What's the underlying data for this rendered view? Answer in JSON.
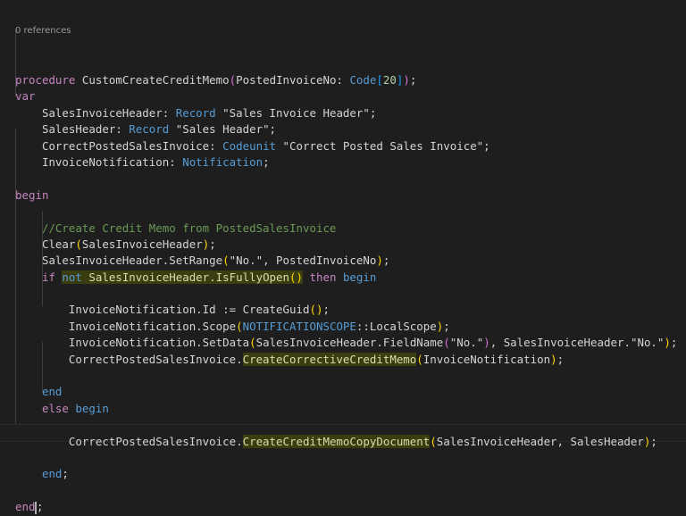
{
  "editor": {
    "codelens": "0 references",
    "lines": [
      [
        [
          "procedure ",
          "k"
        ],
        [
          "CustomCreateCreditMemo",
          "p"
        ],
        [
          "(",
          "b2"
        ],
        [
          "PostedInvoiceNo: ",
          "p"
        ],
        [
          "Code",
          "t"
        ],
        [
          "[",
          "b3"
        ],
        [
          "20",
          "n"
        ],
        [
          "]",
          "b3"
        ],
        [
          ")",
          "b2"
        ],
        [
          ";",
          "p"
        ]
      ],
      [
        [
          "var",
          "k"
        ]
      ],
      [
        [
          "    SalesInvoiceHeader: ",
          "p"
        ],
        [
          "Record",
          "t"
        ],
        [
          " \"Sales Invoice Header\";",
          "s"
        ]
      ],
      [
        [
          "    SalesHeader: ",
          "p"
        ],
        [
          "Record",
          "t"
        ],
        [
          " \"Sales Header\";",
          "s"
        ]
      ],
      [
        [
          "    CorrectPostedSalesInvoice: ",
          "p"
        ],
        [
          "Codeunit",
          "t"
        ],
        [
          " \"Correct Posted Sales Invoice\";",
          "s"
        ]
      ],
      [
        [
          "    InvoiceNotification: ",
          "p"
        ],
        [
          "Notification",
          "t"
        ],
        [
          ";",
          "p"
        ]
      ],
      [],
      [
        [
          "begin",
          "k"
        ]
      ],
      [],
      [
        [
          "    //Create Credit Memo from PostedSalesInvoice",
          "c"
        ]
      ],
      [
        [
          "    Clear",
          "p"
        ],
        [
          "(",
          "b1"
        ],
        [
          "SalesInvoiceHeader",
          "p"
        ],
        [
          ")",
          "b1"
        ],
        [
          ";",
          "p"
        ]
      ],
      [
        [
          "    SalesInvoiceHeader.SetRange",
          "p"
        ],
        [
          "(",
          "b1"
        ],
        [
          "\"No.\", PostedInvoiceNo",
          "p"
        ],
        [
          ")",
          "b1"
        ],
        [
          ";",
          "p"
        ]
      ],
      [
        [
          "    if ",
          "k"
        ],
        [
          "not ",
          "t h"
        ],
        [
          "SalesInvoiceHeader.IsFullyOpen",
          "f h"
        ],
        [
          "()",
          "b1 h"
        ],
        [
          " then ",
          "k"
        ],
        [
          "begin",
          "t"
        ]
      ],
      [],
      [
        [
          "        InvoiceNotification.Id := CreateGuid",
          "p"
        ],
        [
          "()",
          "b1"
        ],
        [
          ";",
          "p"
        ]
      ],
      [
        [
          "        InvoiceNotification.Scope",
          "p"
        ],
        [
          "(",
          "b1"
        ],
        [
          "NOTIFICATIONSCOPE",
          "t"
        ],
        [
          "::LocalScope",
          "p"
        ],
        [
          ")",
          "b1"
        ],
        [
          ";",
          "p"
        ]
      ],
      [
        [
          "        InvoiceNotification.SetData",
          "p"
        ],
        [
          "(",
          "b1"
        ],
        [
          "SalesInvoiceHeader.FieldName",
          "p"
        ],
        [
          "(",
          "b2"
        ],
        [
          "\"No.\"",
          "p"
        ],
        [
          ")",
          "b2"
        ],
        [
          ", SalesInvoiceHeader.\"No.\"",
          "p"
        ],
        [
          ")",
          "b1"
        ],
        [
          ";",
          "p"
        ]
      ],
      [
        [
          "        CorrectPostedSalesInvoice.",
          "p"
        ],
        [
          "CreateCorrectiveCreditMemo",
          "f h"
        ],
        [
          "(",
          "b1"
        ],
        [
          "InvoiceNotification",
          "p"
        ],
        [
          ")",
          "b1"
        ],
        [
          ";",
          "p"
        ]
      ],
      [],
      [
        [
          "    end",
          "t"
        ]
      ],
      [
        [
          "    else ",
          "k"
        ],
        [
          "begin",
          "t"
        ]
      ],
      [],
      [
        [
          "        CorrectPostedSalesInvoice.",
          "p"
        ],
        [
          "CreateCreditMemoCopyDocument",
          "f h"
        ],
        [
          "(",
          "b1"
        ],
        [
          "SalesInvoiceHeader, SalesHeader",
          "p"
        ],
        [
          ")",
          "b1"
        ],
        [
          ";",
          "p"
        ]
      ],
      [],
      [
        [
          "    end",
          "t"
        ],
        [
          ";",
          "p"
        ]
      ],
      [],
      [
        [
          "end",
          "k"
        ],
        [
          ";",
          "p"
        ]
      ]
    ],
    "colors": {
      "background": "#1e1e1e",
      "keyword": "#c586c0",
      "type": "#569cd6",
      "function": "#dcdcaa",
      "comment": "#6a9955",
      "text": "#d4d4d4"
    }
  }
}
